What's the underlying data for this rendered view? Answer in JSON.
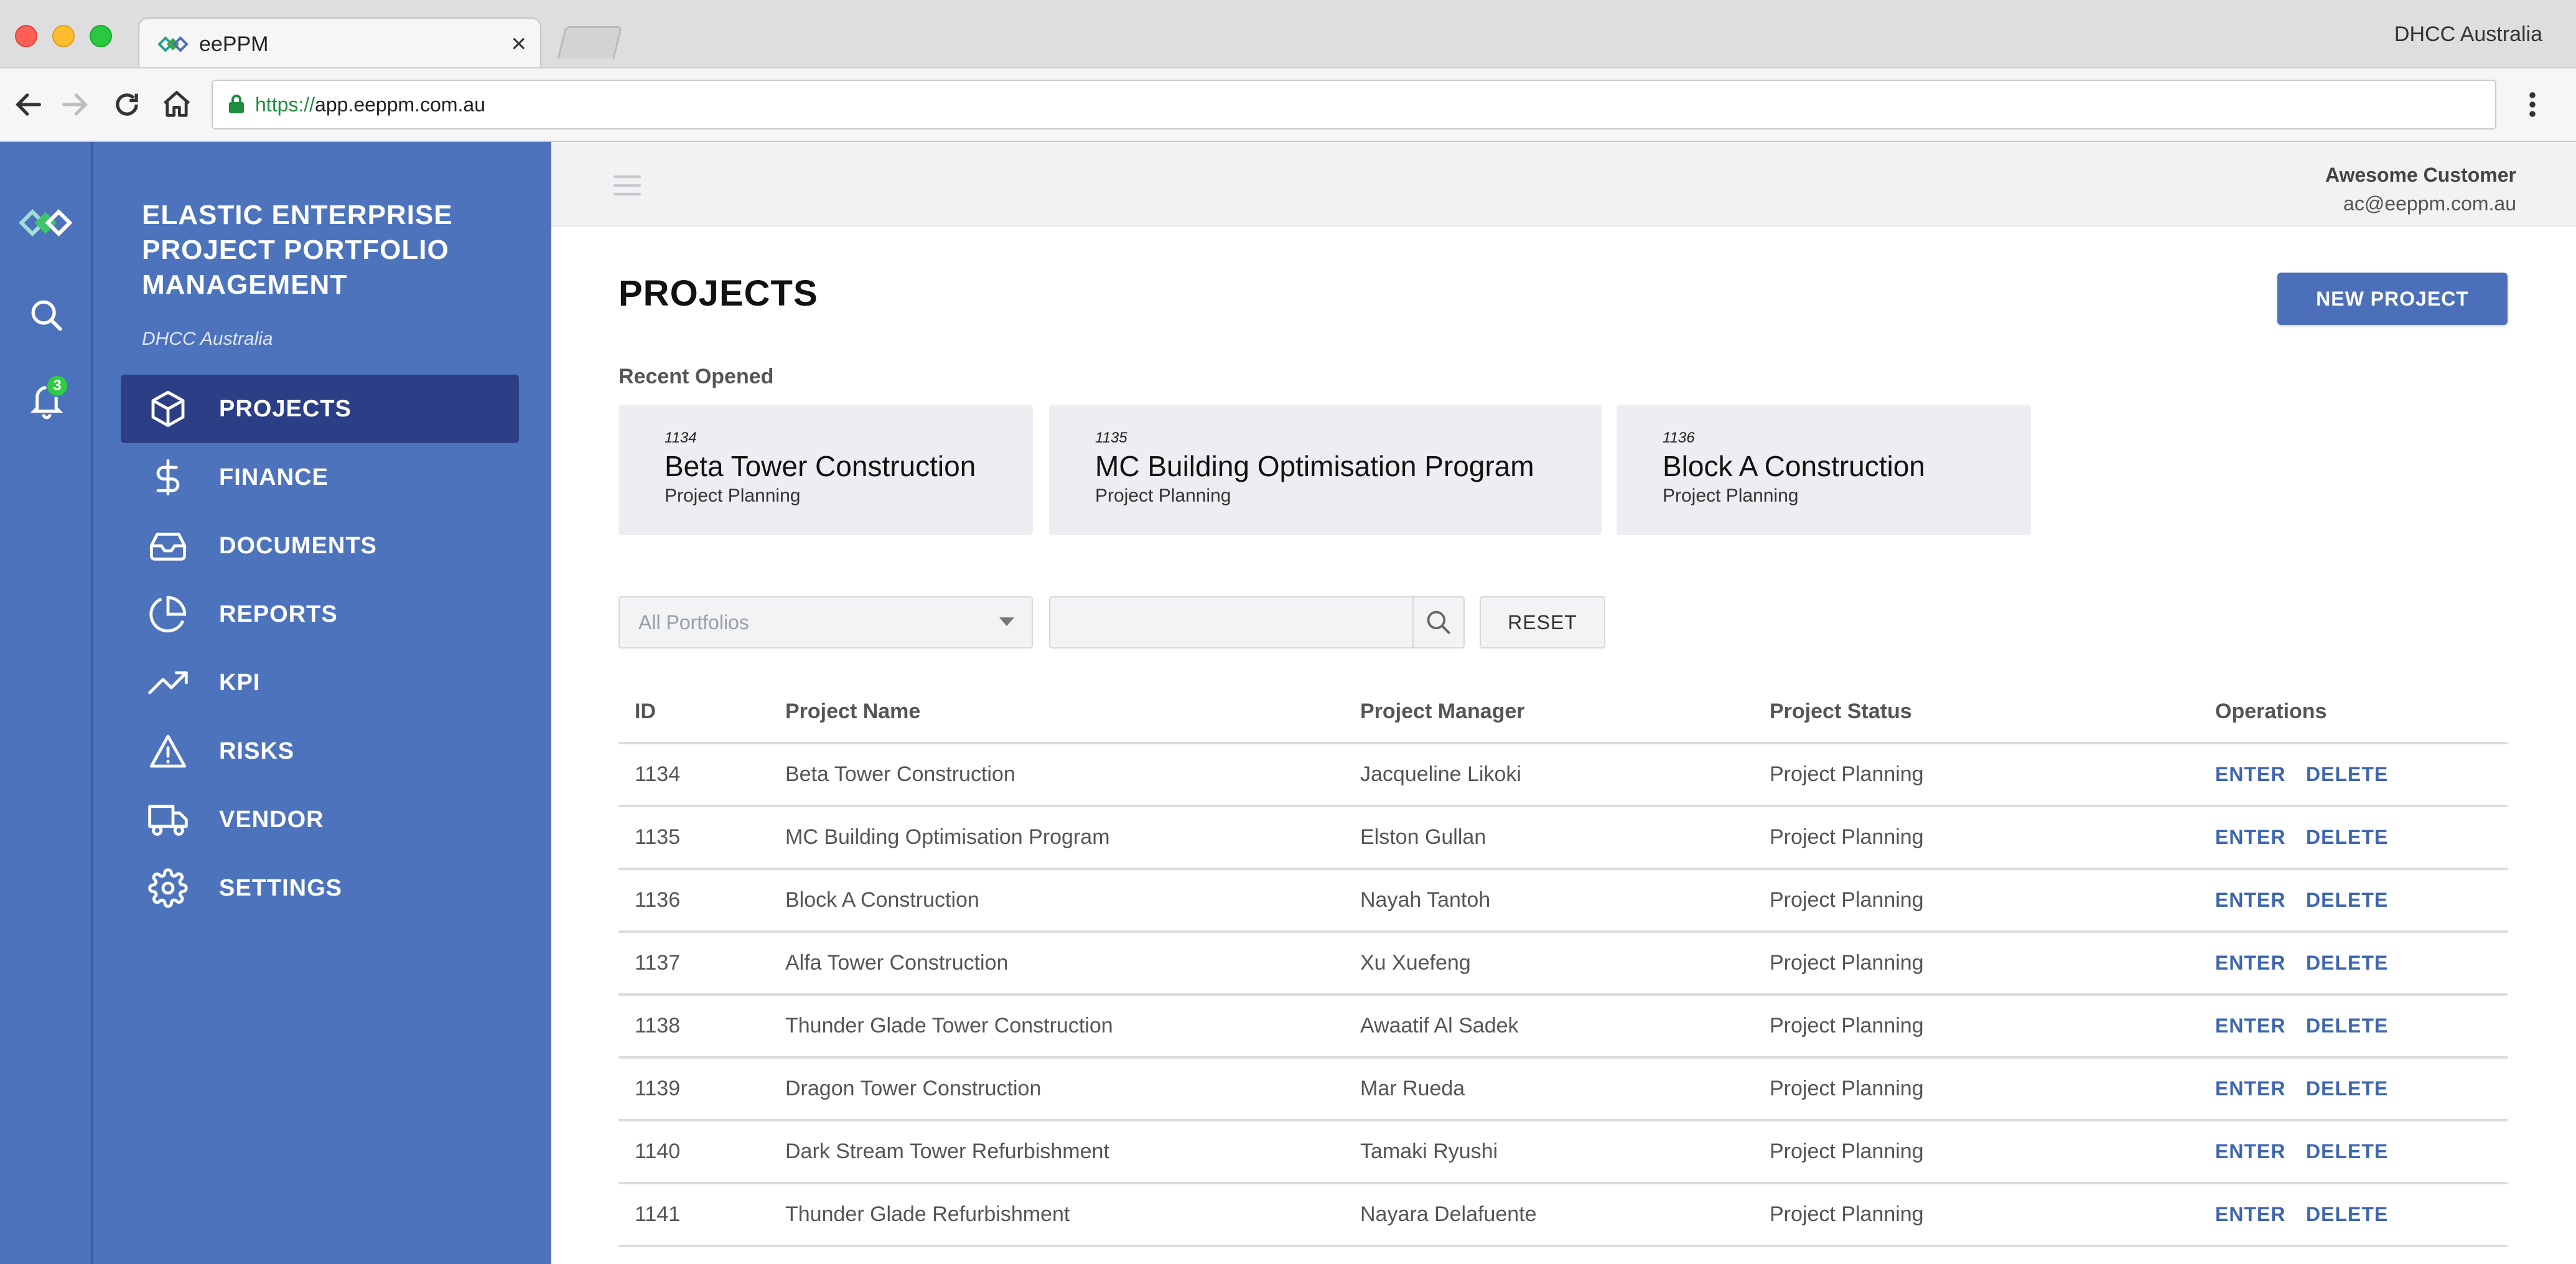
{
  "browser": {
    "tab_title": "eePPM",
    "url_scheme": "https://",
    "url_rest": "app.eeppm.com.au",
    "profile_name": "DHCC Australia"
  },
  "sidebar": {
    "brand": "ELASTIC ENTERPRISE PROJECT PORTFOLIO MANAGEMENT",
    "brand_lines": [
      "ELASTIC ENTERPRISE",
      "PROJECT PORTFOLIO",
      "MANAGEMENT"
    ],
    "org": "DHCC Australia",
    "notification_count": "3",
    "items": [
      {
        "label": "PROJECTS",
        "icon": "box-icon",
        "active": true
      },
      {
        "label": "FINANCE",
        "icon": "dollar-icon"
      },
      {
        "label": "DOCUMENTS",
        "icon": "inbox-icon"
      },
      {
        "label": "REPORTS",
        "icon": "pie-chart-icon"
      },
      {
        "label": "KPI",
        "icon": "trending-up-icon"
      },
      {
        "label": "RISKS",
        "icon": "warning-icon"
      },
      {
        "label": "VENDOR",
        "icon": "truck-icon"
      },
      {
        "label": "SETTINGS",
        "icon": "gear-icon"
      }
    ]
  },
  "user": {
    "name": "Awesome Customer",
    "email": "ac@eeppm.com.au"
  },
  "page": {
    "title": "PROJECTS",
    "new_button": "NEW PROJECT",
    "recent_title": "Recent Opened"
  },
  "recent": [
    {
      "id": "1134",
      "name": "Beta Tower Construction",
      "status": "Project Planning"
    },
    {
      "id": "1135",
      "name": "MC Building Optimisation Program",
      "status": "Project Planning"
    },
    {
      "id": "1136",
      "name": "Block A Construction",
      "status": "Project Planning"
    }
  ],
  "filters": {
    "portfolio_placeholder": "All Portfolios",
    "search_value": "",
    "reset_label": "RESET"
  },
  "table": {
    "columns": [
      "ID",
      "Project Name",
      "Project Manager",
      "Project Status",
      "Operations"
    ],
    "enter_label": "ENTER",
    "delete_label": "DELETE",
    "rows": [
      {
        "id": "1134",
        "name": "Beta Tower Construction",
        "manager": "Jacqueline Likoki",
        "status": "Project Planning"
      },
      {
        "id": "1135",
        "name": "MC Building Optimisation Program",
        "manager": "Elston Gullan",
        "status": "Project Planning"
      },
      {
        "id": "1136",
        "name": "Block A Construction",
        "manager": "Nayah Tantoh",
        "status": "Project Planning"
      },
      {
        "id": "1137",
        "name": "Alfa Tower Construction",
        "manager": "Xu Xuefeng",
        "status": "Project Planning"
      },
      {
        "id": "1138",
        "name": "Thunder Glade Tower Construction",
        "manager": "Awaatif Al Sadek",
        "status": "Project Planning"
      },
      {
        "id": "1139",
        "name": "Dragon Tower Construction",
        "manager": "Mar Rueda",
        "status": "Project Planning"
      },
      {
        "id": "1140",
        "name": "Dark Stream Tower Refurbishment",
        "manager": "Tamaki Ryushi",
        "status": "Project Planning"
      },
      {
        "id": "1141",
        "name": "Thunder Glade Refurbishment",
        "manager": "Nayara Delafuente",
        "status": "Project Planning"
      }
    ]
  },
  "colors": {
    "sidebar": "#4d73bd",
    "sidebar_active": "#2c3f86",
    "accent": "#4b70b9",
    "link": "#3e66b0",
    "badge": "#2ecc40"
  }
}
